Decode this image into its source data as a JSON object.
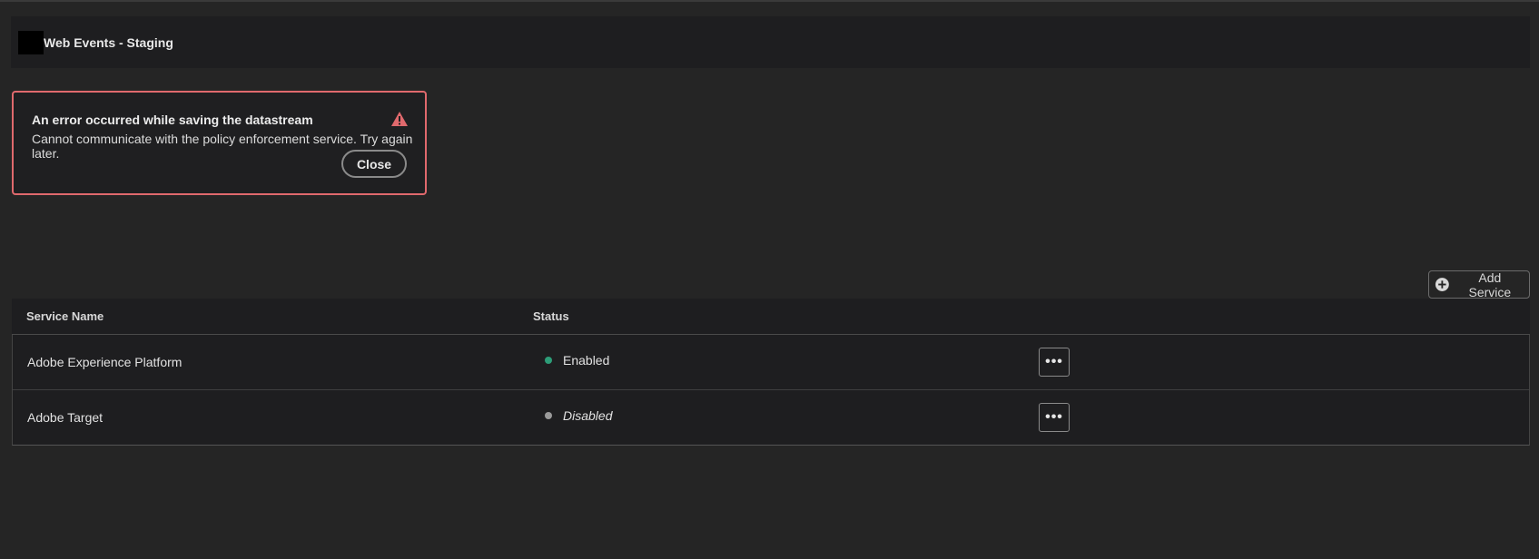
{
  "header": {
    "title": "Web Events - Staging"
  },
  "error_toast": {
    "title": "An error occurred while saving the datastream",
    "message": "Cannot communicate with the policy enforcement service. Try again later.",
    "close_label": "Close",
    "border_color": "#e0696d",
    "icon": "alert-icon"
  },
  "toolbar": {
    "add_service_label": "Add Service",
    "add_icon": "plus-circle-icon"
  },
  "table": {
    "columns": [
      "Service Name",
      "Status"
    ],
    "rows": [
      {
        "name": "Adobe Experience Platform",
        "status": "Enabled",
        "status_color": "#2d9d78",
        "more_icon": "ellipsis-icon"
      },
      {
        "name": "Adobe Target",
        "status": "Disabled",
        "status_color": "#9a9a9a",
        "more_icon": "ellipsis-icon"
      }
    ]
  }
}
